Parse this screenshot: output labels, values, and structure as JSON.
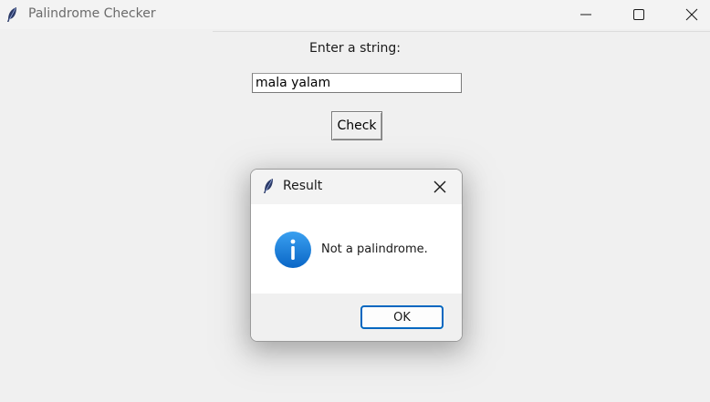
{
  "window": {
    "title": "Palindrome Checker",
    "icon": "feather-icon",
    "controls": [
      "minimize-icon",
      "maximize-icon",
      "close-icon"
    ]
  },
  "form": {
    "prompt_label": "Enter a string:",
    "input_value": "mala yalam",
    "check_label": "Check"
  },
  "dialog": {
    "title": "Result",
    "icon": "info-icon",
    "message": "Not a palindrome.",
    "ok_label": "OK",
    "accent": "#0067c0"
  }
}
